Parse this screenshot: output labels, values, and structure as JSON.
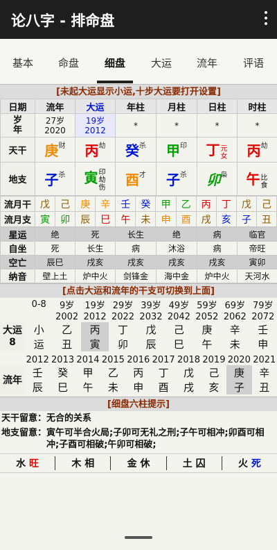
{
  "app": {
    "title": "论八字 - 排命盘",
    "menu_icon": "more-vert-icon"
  },
  "tabs": [
    "基本",
    "命盘",
    "细盘",
    "大运",
    "流年",
    "评语"
  ],
  "active_tab": "细盘",
  "band1": "[未起大运显示小运,十步大运要打开设置]",
  "header": [
    "日期",
    "流年",
    "大运",
    "年柱",
    "月柱",
    "日柱",
    "时柱"
  ],
  "sui": {
    "label": "岁\n年",
    "liunian": [
      "27岁",
      "2020"
    ],
    "dayun": [
      "19岁",
      "2012"
    ],
    "star": "*"
  },
  "tiangan": {
    "label": "天干",
    "cells": [
      {
        "char": "庚",
        "sup": "财"
      },
      {
        "char": "丙",
        "sup": "劫"
      },
      {
        "char": "癸",
        "sup": "杀"
      },
      {
        "char": "甲",
        "sup": "印"
      },
      {
        "char": "丁",
        "sup": "元女"
      },
      {
        "char": "丙",
        "sup": "劫"
      }
    ]
  },
  "dizhi": {
    "label": "地支",
    "cells": [
      {
        "char": "子",
        "top": "杀",
        "sub": ""
      },
      {
        "char": "寅",
        "top": "印",
        "sub": "劫伤"
      },
      {
        "char": "酉",
        "top": "才",
        "sub": ""
      },
      {
        "char": "子",
        "top": "杀",
        "sub": ""
      },
      {
        "char": "卯",
        "top": "枭",
        "sub": ""
      },
      {
        "char": "午",
        "top": "比",
        "sub": "食"
      }
    ]
  },
  "liuyue_gan": {
    "label": "流月干",
    "chars": [
      "戊",
      "己",
      "庚",
      "辛",
      "壬",
      "癸",
      "甲",
      "乙",
      "丙",
      "丁",
      "戊",
      "己"
    ]
  },
  "liuyue_zhi": {
    "label": "流月支",
    "chars": [
      "寅",
      "卯",
      "辰",
      "巳",
      "午",
      "未",
      "申",
      "酉",
      "戌",
      "亥",
      "子",
      "丑"
    ]
  },
  "xingyun": {
    "label": "星运",
    "vals": [
      "绝",
      "死",
      "长生",
      "绝",
      "病",
      "临官"
    ]
  },
  "zizuo": {
    "label": "自坐",
    "vals": [
      "死",
      "长生",
      "病",
      "沐浴",
      "病",
      "帝旺"
    ]
  },
  "kongwang": {
    "label": "空亡",
    "vals": [
      "辰巳",
      "戌亥",
      "戌亥",
      "戌亥",
      "戌亥",
      "寅卯"
    ]
  },
  "nayin": {
    "label": "纳音",
    "vals": [
      "壁上土",
      "炉中火",
      "剑锋金",
      "海中金",
      "炉中火",
      "天河水"
    ]
  },
  "band2": "[点击大运和流年的干支可切换到上面]",
  "dayun": {
    "label": "大运\n8",
    "ages": [
      "0-8",
      "9岁",
      "19岁",
      "29岁",
      "39岁",
      "49岁",
      "59岁",
      "69岁",
      "79岁"
    ],
    "years": [
      "",
      "2002",
      "2012",
      "2022",
      "2032",
      "2042",
      "2052",
      "2062",
      "2072"
    ],
    "gan": [
      "小",
      "乙",
      "丙",
      "丁",
      "戊",
      "己",
      "庚",
      "辛",
      "壬"
    ],
    "zhi": [
      "运",
      "丑",
      "寅",
      "卯",
      "辰",
      "巳",
      "午",
      "未",
      "申"
    ]
  },
  "liunian": {
    "label": "流年",
    "years": [
      "2012",
      "2013",
      "2014",
      "2015",
      "2016",
      "2017",
      "2018",
      "2019",
      "2020",
      "2021"
    ],
    "gan": [
      "壬",
      "癸",
      "甲",
      "乙",
      "丙",
      "丁",
      "戊",
      "己",
      "庚",
      "辛"
    ],
    "zhi": [
      "辰",
      "巳",
      "午",
      "未",
      "申",
      "酉",
      "戌",
      "亥",
      "子",
      "丑"
    ]
  },
  "band3": "[细盘六柱提示]",
  "tips": {
    "tiangan_label": "天干留意：",
    "tiangan_text": "无合的关系",
    "dizhi_label": "地支留意：",
    "dizhi_text": "寅午可半合火局;子卯可无礼之刑;子午可相冲;卯酉可相冲;子酉可相破;午卯可相破;"
  },
  "wuxing": [
    {
      "el": "水",
      "state": "旺"
    },
    {
      "el": "木",
      "state": "相"
    },
    {
      "el": "金",
      "state": "休"
    },
    {
      "el": "土",
      "state": "囚"
    },
    {
      "el": "火",
      "state": "死"
    }
  ],
  "colors": {
    "fire": "#e00000",
    "wood": "#00a000",
    "metal": "#f08a00",
    "water": "#0014d8",
    "earth": "#8a5a00"
  }
}
